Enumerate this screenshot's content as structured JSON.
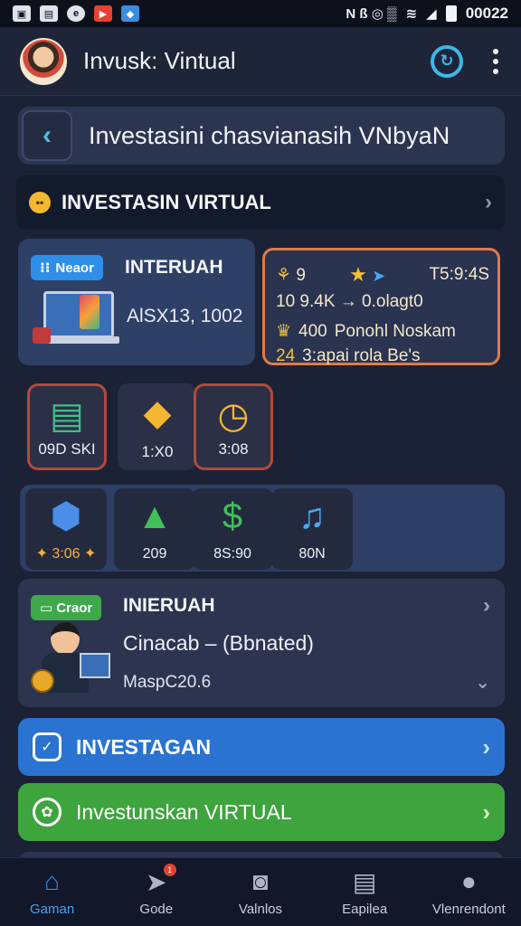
{
  "status_bar": {
    "time": "00022",
    "left_icons": [
      "photo-icon",
      "image-icon",
      "browser-icon",
      "youtube-icon",
      "store-icon"
    ],
    "right_glyphs": "N ß ◎ ▒"
  },
  "app_bar": {
    "title": "Invusk: Vintual"
  },
  "search": {
    "text": "Investasini chasvianasih VNbyaN"
  },
  "section": {
    "title": "INVESTASIN VIRTUAL"
  },
  "card_a": {
    "pill": "Neaor",
    "title": "INTERUAH",
    "subtitle": "AlSX13, 1002"
  },
  "card_b": {
    "row1_left": "9",
    "row1_right": "T5:9:4S",
    "row2": "10 9.4K → 0.olagt0",
    "row3_prefix": "400",
    "row3_text": "Ponohl Noskam",
    "row4_prefix": "24",
    "row4_text": "3:apai  rola Be's"
  },
  "tiles_row1": [
    {
      "label": "09D SKI"
    },
    {
      "label": "1:X0"
    },
    {
      "label": "3:08"
    }
  ],
  "tiles_row2": [
    {
      "label": "✦ 3:06 ✦"
    },
    {
      "label": "209"
    },
    {
      "label": "8S:90"
    },
    {
      "label": "80N"
    }
  ],
  "card_c": {
    "pill": "Craor",
    "title": "INIERUAH",
    "subtitle": "Cinacab – (Bbnated)",
    "meta": "MaspC20.6"
  },
  "btn_blue": {
    "label": "INVESTAGAN"
  },
  "btn_green": {
    "label": "Investunskan VIRTUAL"
  },
  "bottom_nav": [
    {
      "label": "Gaman",
      "icon": "home-icon",
      "active": true
    },
    {
      "label": "Gode",
      "icon": "send-icon",
      "badge": "1"
    },
    {
      "label": "Valnlos",
      "icon": "wallet-icon"
    },
    {
      "label": "Eapilea",
      "icon": "document-icon"
    },
    {
      "label": "Vlenrendont",
      "icon": "profile-icon"
    }
  ],
  "colors": {
    "accent": "#2f8ee8",
    "success": "#3ea43e",
    "warning_border": "#e07a4a",
    "background": "#1b2236"
  }
}
